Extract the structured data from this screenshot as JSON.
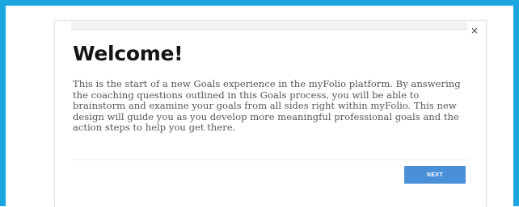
{
  "modal": {
    "title": "Welcome!",
    "body": "This is the start of a new Goals experience in the myFolio platform. By answering the coaching questions outlined in this Goals process, you will be able to brainstorm and examine your goals from all sides right within myFolio. This new design will guide you as you develop more meaningful professional goals and the action steps to help you get there.",
    "close_icon": "close-icon",
    "next_label": "NEXT"
  },
  "colors": {
    "frame_border": "#1aa6de",
    "button": "#4a90d9",
    "title": "#151515",
    "body_text": "#555555"
  }
}
